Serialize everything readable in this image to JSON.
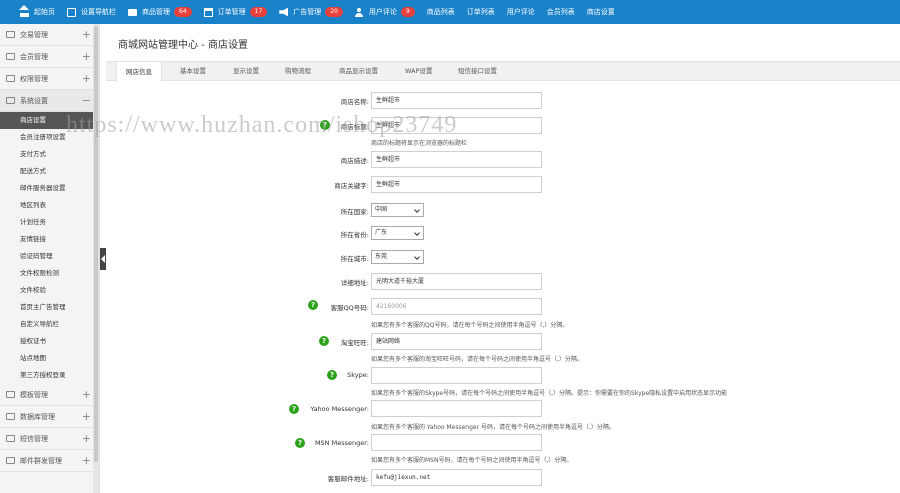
{
  "topnav": [
    {
      "label": "起始页",
      "icon": "home-icon"
    },
    {
      "label": "设置导航栏",
      "icon": "settings-box-icon"
    },
    {
      "label": "商品管理",
      "icon": "folder-icon",
      "badge": "64"
    },
    {
      "label": "订单管理",
      "icon": "calendar-icon",
      "badge": "17"
    },
    {
      "label": "广告管理",
      "icon": "megaphone-icon",
      "badge": "20"
    },
    {
      "label": "用户评论",
      "icon": "user-icon",
      "badge": "9"
    },
    {
      "label": "商品列表"
    },
    {
      "label": "订单列表"
    },
    {
      "label": "用户评论"
    },
    {
      "label": "会员列表"
    },
    {
      "label": "商店设置"
    }
  ],
  "sidebar": {
    "groups_top": [
      {
        "label": "交易管理"
      },
      {
        "label": "会员管理"
      },
      {
        "label": "权限管理"
      }
    ],
    "open_group": {
      "label": "系统设置",
      "toggle": "−"
    },
    "items": [
      {
        "label": "商店设置"
      },
      {
        "label": "会员注册项设置"
      },
      {
        "label": "支付方式"
      },
      {
        "label": "配送方式"
      },
      {
        "label": "邮件服务器设置"
      },
      {
        "label": "地区列表"
      },
      {
        "label": "计划任务"
      },
      {
        "label": "友情链接"
      },
      {
        "label": "验证码管理"
      },
      {
        "label": "文件权限检测"
      },
      {
        "label": "文件校验"
      },
      {
        "label": "首页主广告管理"
      },
      {
        "label": "自定义导航栏"
      },
      {
        "label": "授权证书"
      },
      {
        "label": "站点地图"
      },
      {
        "label": "第三方授权登录"
      }
    ],
    "groups_bottom": [
      {
        "label": "模板管理"
      },
      {
        "label": "数据库管理"
      },
      {
        "label": "短信管理"
      },
      {
        "label": "邮件群发管理"
      }
    ],
    "toggle_plus": "+"
  },
  "header": {
    "title": "商城网站管理中心 - 商店设置"
  },
  "tabs": [
    {
      "label": "网店信息"
    },
    {
      "label": "基本设置"
    },
    {
      "label": "显示设置"
    },
    {
      "label": "购物流程"
    },
    {
      "label": "商品显示设置"
    },
    {
      "label": "WAP设置"
    },
    {
      "label": "短信接口设置"
    }
  ],
  "form": {
    "shop_name": {
      "label": "商店名称:",
      "value": "生鲜超市"
    },
    "shop_title": {
      "label": "商店标题:",
      "value": "生鲜超市",
      "hint": "商店的标题将显示在浏览器的标题栏"
    },
    "shop_desc": {
      "label": "商店描述:",
      "value": "生鲜超市"
    },
    "shop_keywords": {
      "label": "商店关键字:",
      "value": "生鲜超市"
    },
    "country": {
      "label": "所在国家:",
      "value": "中国"
    },
    "province": {
      "label": "所在省份:",
      "value": "广东"
    },
    "city": {
      "label": "所在城市:",
      "value": "东莞"
    },
    "address": {
      "label": "详细地址:",
      "value": "光明大道千裕大厦"
    },
    "qq": {
      "label": "客服QQ号码:",
      "placeholder": "42160006",
      "hint": "如果您有多个客服的QQ号码，请在每个号码之间使用半角逗号（,）分隔。"
    },
    "wangwang": {
      "label": "淘宝旺旺:",
      "value": "建站网络",
      "hint": "如果您有多个客服的淘宝旺旺号码，请在每个号码之间使用半角逗号（,）分隔。"
    },
    "skype": {
      "label": "Skype:",
      "value": "",
      "hint": "如果您有多个客服的Skype号码，请在每个号码之间使用半角逗号（,）分隔。提示：你需要在你的Skype隐私设置中启用状态显示功能"
    },
    "yahoo": {
      "label": "Yahoo Messenger:",
      "value": "",
      "hint": "如果您有多个客服的 Yahoo Messenger 号码，请在每个号码之间使用半角逗号（,）分隔。"
    },
    "msn": {
      "label": "MSN Messenger:",
      "value": "",
      "hint": "如果您有多个客服的MSN号码，请在每个号码之间使用半角逗号（,）分隔。"
    },
    "service_email": {
      "label": "客服邮件地址:",
      "value": "kefu@jiexun.net"
    }
  },
  "watermark": "https://www.huzhan.com/ishop23749",
  "colors": {
    "topbar": "#1a82c9",
    "badge": "#e8413b",
    "help_icon": "#2aa31a",
    "active_sidebar": "#555555"
  }
}
